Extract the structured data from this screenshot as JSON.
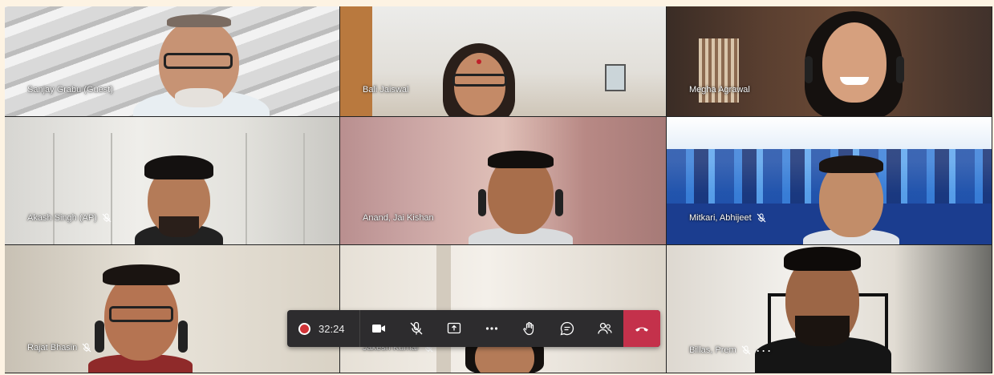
{
  "participants": [
    {
      "name": "Sanjay Grabu (Guest)",
      "muted": false
    },
    {
      "name": "Bali Jaiswal",
      "muted": false
    },
    {
      "name": "Megha Agrawal",
      "muted": false
    },
    {
      "name": "Akash Singh (AP)",
      "muted": true
    },
    {
      "name": "Anand, Jai Kishan",
      "muted": false
    },
    {
      "name": "Mitkari, Abhijeet",
      "muted": true
    },
    {
      "name": "Rajat Bhasin",
      "muted": true
    },
    {
      "name": "Jakesh Kumar",
      "muted": true
    },
    {
      "name": "Billas, Prem",
      "muted": true
    }
  ],
  "controls": {
    "recording_time": "32:24",
    "icons": [
      "record-icon",
      "camera-icon",
      "mic-off-icon",
      "share-screen-icon",
      "more-icon",
      "raise-hand-icon",
      "chat-icon",
      "participants-icon",
      "hang-up-icon"
    ],
    "hangup_color": "#c4314b",
    "record_color": "#d13438",
    "bar_color": "#2d2c2e"
  }
}
